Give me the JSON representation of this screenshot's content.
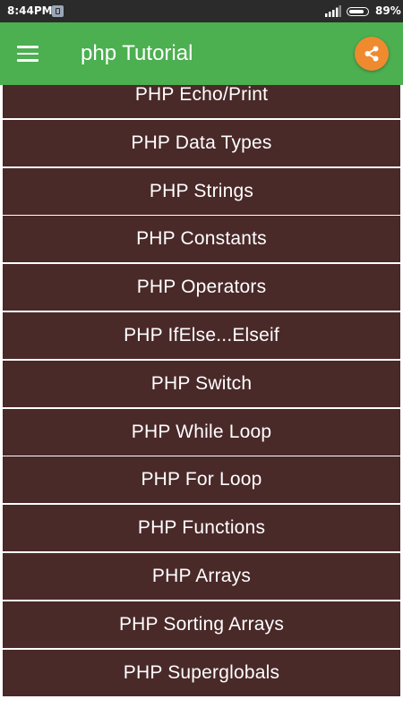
{
  "status_bar": {
    "time": "8:44PM",
    "battery_text": "89%",
    "battery_level": 0.89,
    "notification_icon": "gallery-icon",
    "signal_icon": "cell-signal-icon"
  },
  "app_bar": {
    "title": "php Tutorial",
    "menu_icon": "hamburger-menu-icon",
    "share_icon": "share-icon",
    "color": "#4caf50",
    "share_color": "#f08a2f"
  },
  "topics": {
    "item_color": "#4a2929",
    "items": [
      "PHP Echo/Print",
      "PHP Data Types",
      "PHP Strings",
      "PHP Constants",
      "PHP Operators",
      "PHP IfElse...Elseif",
      "PHP Switch",
      "PHP While Loop",
      "PHP For Loop",
      "PHP Functions",
      "PHP Arrays",
      "PHP Sorting Arrays",
      "PHP Superglobals"
    ]
  }
}
